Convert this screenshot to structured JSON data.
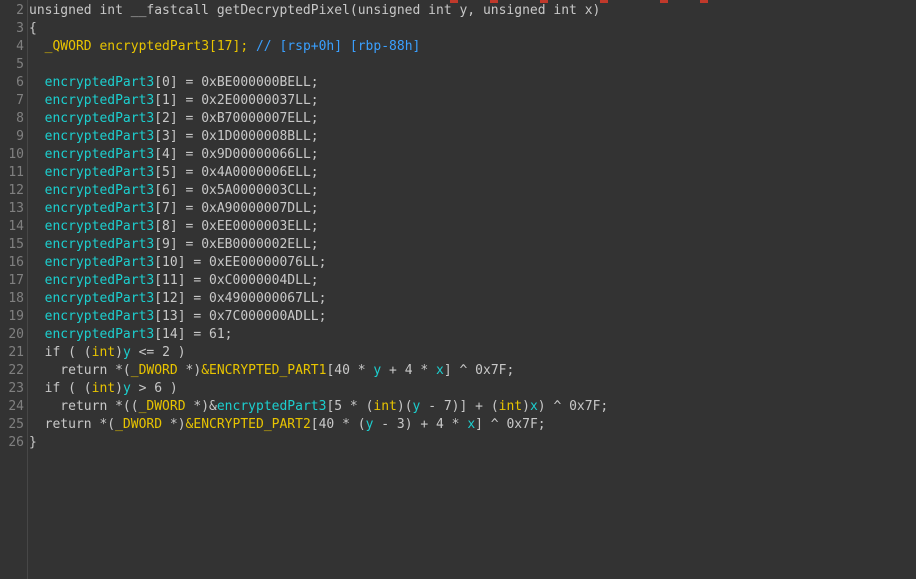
{
  "editor": {
    "lines": [
      {
        "n": "2",
        "tokens": [
          {
            "t": "unsigned int __fastcall getDecryptedPixel(unsigned int y, unsigned int x)",
            "c": "fn"
          }
        ]
      },
      {
        "n": "3",
        "tokens": [
          {
            "t": "{",
            "c": "fn"
          }
        ]
      },
      {
        "n": "4",
        "tokens": [
          {
            "t": "  ",
            "c": "fn"
          },
          {
            "t": "_QWORD encryptedPart3[17];",
            "c": "ty"
          },
          {
            "t": " // [rsp+0h] [rbp-88h]",
            "c": "cm"
          }
        ]
      },
      {
        "n": "5",
        "tokens": []
      },
      {
        "n": "6",
        "tokens": [
          {
            "t": "  ",
            "c": "fn"
          },
          {
            "t": "encryptedPart3",
            "c": "id"
          },
          {
            "t": "[0] = 0xBE000000BELL;",
            "c": "fn"
          }
        ]
      },
      {
        "n": "7",
        "tokens": [
          {
            "t": "  ",
            "c": "fn"
          },
          {
            "t": "encryptedPart3",
            "c": "id"
          },
          {
            "t": "[1] = 0x2E00000037LL;",
            "c": "fn"
          }
        ]
      },
      {
        "n": "8",
        "tokens": [
          {
            "t": "  ",
            "c": "fn"
          },
          {
            "t": "encryptedPart3",
            "c": "id"
          },
          {
            "t": "[2] = 0xB70000007ELL;",
            "c": "fn"
          }
        ]
      },
      {
        "n": "9",
        "tokens": [
          {
            "t": "  ",
            "c": "fn"
          },
          {
            "t": "encryptedPart3",
            "c": "id"
          },
          {
            "t": "[3] = 0x1D0000008BLL;",
            "c": "fn"
          }
        ]
      },
      {
        "n": "10",
        "tokens": [
          {
            "t": "  ",
            "c": "fn"
          },
          {
            "t": "encryptedPart3",
            "c": "id"
          },
          {
            "t": "[4] = 0x9D00000066LL;",
            "c": "fn"
          }
        ]
      },
      {
        "n": "11",
        "tokens": [
          {
            "t": "  ",
            "c": "fn"
          },
          {
            "t": "encryptedPart3",
            "c": "id"
          },
          {
            "t": "[5] = 0x4A0000006ELL;",
            "c": "fn"
          }
        ]
      },
      {
        "n": "12",
        "tokens": [
          {
            "t": "  ",
            "c": "fn"
          },
          {
            "t": "encryptedPart3",
            "c": "id"
          },
          {
            "t": "[6] = 0x5A0000003CLL;",
            "c": "fn"
          }
        ]
      },
      {
        "n": "13",
        "tokens": [
          {
            "t": "  ",
            "c": "fn"
          },
          {
            "t": "encryptedPart3",
            "c": "id"
          },
          {
            "t": "[7] = 0xA90000007DLL;",
            "c": "fn"
          }
        ]
      },
      {
        "n": "14",
        "tokens": [
          {
            "t": "  ",
            "c": "fn"
          },
          {
            "t": "encryptedPart3",
            "c": "id"
          },
          {
            "t": "[8] = 0xEE0000003ELL;",
            "c": "fn"
          }
        ]
      },
      {
        "n": "15",
        "tokens": [
          {
            "t": "  ",
            "c": "fn"
          },
          {
            "t": "encryptedPart3",
            "c": "id"
          },
          {
            "t": "[9] = 0xEB0000002ELL;",
            "c": "fn"
          }
        ]
      },
      {
        "n": "16",
        "tokens": [
          {
            "t": "  ",
            "c": "fn"
          },
          {
            "t": "encryptedPart3",
            "c": "id"
          },
          {
            "t": "[10] = 0xEE00000076LL;",
            "c": "fn"
          }
        ]
      },
      {
        "n": "17",
        "tokens": [
          {
            "t": "  ",
            "c": "fn"
          },
          {
            "t": "encryptedPart3",
            "c": "id"
          },
          {
            "t": "[11] = 0xC0000004DLL;",
            "c": "fn"
          }
        ]
      },
      {
        "n": "18",
        "tokens": [
          {
            "t": "  ",
            "c": "fn"
          },
          {
            "t": "encryptedPart3",
            "c": "id"
          },
          {
            "t": "[12] = 0x4900000067LL;",
            "c": "fn"
          }
        ]
      },
      {
        "n": "19",
        "tokens": [
          {
            "t": "  ",
            "c": "fn"
          },
          {
            "t": "encryptedPart3",
            "c": "id"
          },
          {
            "t": "[13] = 0x7C000000ADLL;",
            "c": "fn"
          }
        ]
      },
      {
        "n": "20",
        "tokens": [
          {
            "t": "  ",
            "c": "fn"
          },
          {
            "t": "encryptedPart3",
            "c": "id"
          },
          {
            "t": "[14] = 61;",
            "c": "fn"
          }
        ]
      },
      {
        "n": "21",
        "tokens": [
          {
            "t": "  if ( (",
            "c": "fn"
          },
          {
            "t": "int",
            "c": "ty"
          },
          {
            "t": ")",
            "c": "fn"
          },
          {
            "t": "y",
            "c": "id"
          },
          {
            "t": " <= 2 )",
            "c": "fn"
          }
        ]
      },
      {
        "n": "22",
        "tokens": [
          {
            "t": "    return *(",
            "c": "fn"
          },
          {
            "t": "_DWORD",
            "c": "ty"
          },
          {
            "t": " *)",
            "c": "fn"
          },
          {
            "t": "&ENCRYPTED_PART1",
            "c": "ty"
          },
          {
            "t": "[40 * ",
            "c": "fn"
          },
          {
            "t": "y",
            "c": "id"
          },
          {
            "t": " + 4 * ",
            "c": "fn"
          },
          {
            "t": "x",
            "c": "id"
          },
          {
            "t": "] ^ 0x7F;",
            "c": "fn"
          }
        ]
      },
      {
        "n": "23",
        "tokens": [
          {
            "t": "  if ( (",
            "c": "fn"
          },
          {
            "t": "int",
            "c": "ty"
          },
          {
            "t": ")",
            "c": "fn"
          },
          {
            "t": "y",
            "c": "id"
          },
          {
            "t": " > 6 )",
            "c": "fn"
          }
        ]
      },
      {
        "n": "24",
        "tokens": [
          {
            "t": "    return *((",
            "c": "fn"
          },
          {
            "t": "_DWORD",
            "c": "ty"
          },
          {
            "t": " *)&",
            "c": "fn"
          },
          {
            "t": "encryptedPart3",
            "c": "id"
          },
          {
            "t": "[5 * (",
            "c": "fn"
          },
          {
            "t": "int",
            "c": "ty"
          },
          {
            "t": ")(",
            "c": "fn"
          },
          {
            "t": "y",
            "c": "id"
          },
          {
            "t": " - 7)] + (",
            "c": "fn"
          },
          {
            "t": "int",
            "c": "ty"
          },
          {
            "t": ")",
            "c": "fn"
          },
          {
            "t": "x",
            "c": "id"
          },
          {
            "t": ") ^ 0x7F;",
            "c": "fn"
          }
        ]
      },
      {
        "n": "25",
        "tokens": [
          {
            "t": "  return *(",
            "c": "fn"
          },
          {
            "t": "_DWORD",
            "c": "ty"
          },
          {
            "t": " *)",
            "c": "fn"
          },
          {
            "t": "&ENCRYPTED_PART2",
            "c": "ty"
          },
          {
            "t": "[40 * (",
            "c": "fn"
          },
          {
            "t": "y",
            "c": "id"
          },
          {
            "t": " - 3) + 4 * ",
            "c": "fn"
          },
          {
            "t": "x",
            "c": "id"
          },
          {
            "t": "] ^ 0x7F;",
            "c": "fn"
          }
        ]
      },
      {
        "n": "26",
        "tokens": [
          {
            "t": "}",
            "c": "fn"
          }
        ]
      }
    ]
  },
  "colors": {
    "background": "#333333",
    "text": "#c8c8c8",
    "type": "#e8c400",
    "identifier": "#1ccfcf",
    "comment": "#3aa0ff",
    "line_number": "#808080"
  }
}
